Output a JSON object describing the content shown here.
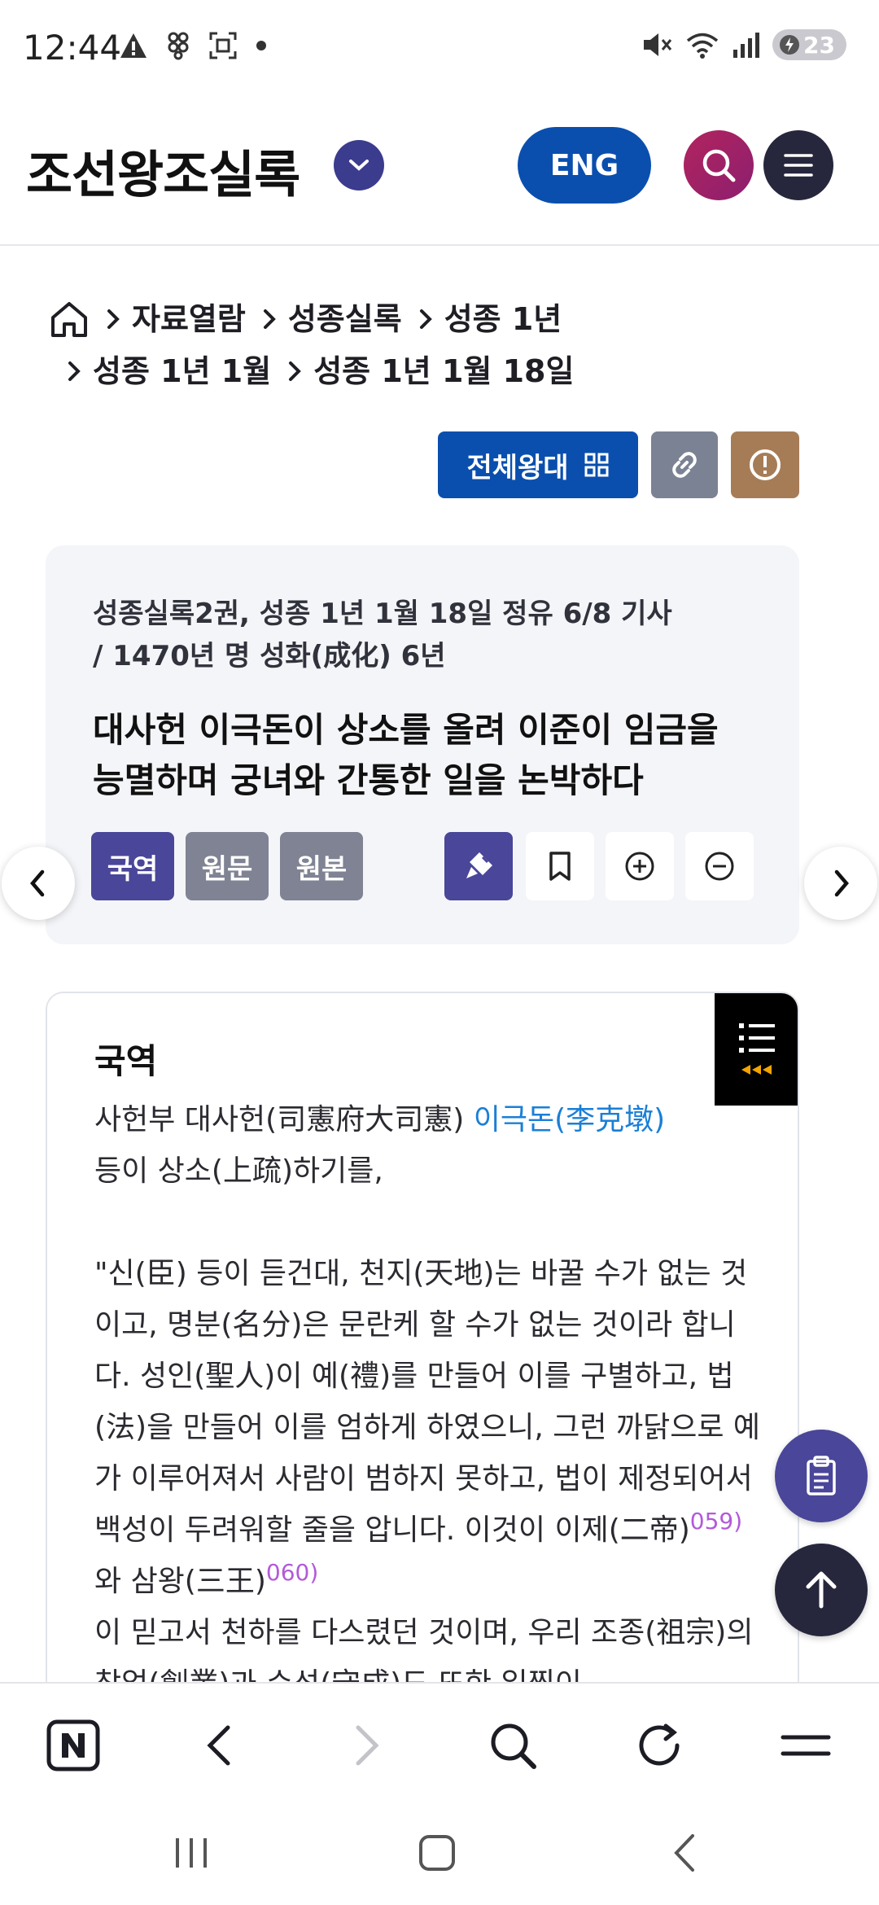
{
  "status_bar": {
    "time": "12:44",
    "battery": "23",
    "icons_left": [
      "warning-icon",
      "pinwheel-icon",
      "screenshot-icon",
      "dot-icon"
    ],
    "icons_right": [
      "mute-icon",
      "wifi-icon",
      "signal-icon",
      "battery-icon"
    ]
  },
  "header": {
    "title": "조선왕조실록",
    "lang_button": "ENG"
  },
  "breadcrumb": {
    "items": [
      "자료열람",
      "성종실록",
      "성종 1년",
      "성종 1년 1월",
      "성종 1년 1월 18일"
    ]
  },
  "actions": {
    "full_button": "전체왕대"
  },
  "article": {
    "meta_line1": "성종실록2권, 성종 1년 1월 18일 정유 6/8 기사",
    "meta_line2": "/ 1470년 명 성화(成化) 6년",
    "title_line1": "대사헌 이극돈이 상소를 올려 이준이 임금을",
    "title_line2": "능멸하며 궁녀와 간통한 일을 논박하다",
    "tabs": [
      "국역",
      "원문",
      "원본"
    ],
    "active_tab": "국역"
  },
  "content": {
    "heading": "국역",
    "p1_prefix": "사헌부 대사헌(司憲府大司憲) ",
    "p1_link": "이극돈(李克墩)",
    "p1_suffix": "등이 상소(上疏)하기를,",
    "p2_a": "\"신(臣) 등이 듣건대, 천지(天地)는 바꿀 수가 없는 것이고, 명분(名分)은 문란케 할 수가 없는 것이라 합니다. 성인(聖人)이 예(禮)를 만들어 이를 구별하고, 법(法)을 만들어 이를 엄하게 하였으니, 그런 까닭으로 예가 이루어져서 사람이 범하지 못하고, 법이 제정되어서 백성이 두려워할 줄을 압니다. 이것이 이제(二帝)",
    "fn1": "059)",
    "p2_b": " 와 삼왕(三王)",
    "fn2": "060)",
    "p2_c": "이 믿고서 천하를 다스렸던 것이며, 우리 조종(祖宗)의 창업(創業)과 수성(守成)도 또한 일찍이"
  },
  "colors": {
    "primary_blue": "#0a4fae",
    "purple": "#4a4699",
    "navy": "#26273d",
    "link": "#1a7fd6",
    "footnote": "#b35ad8"
  }
}
